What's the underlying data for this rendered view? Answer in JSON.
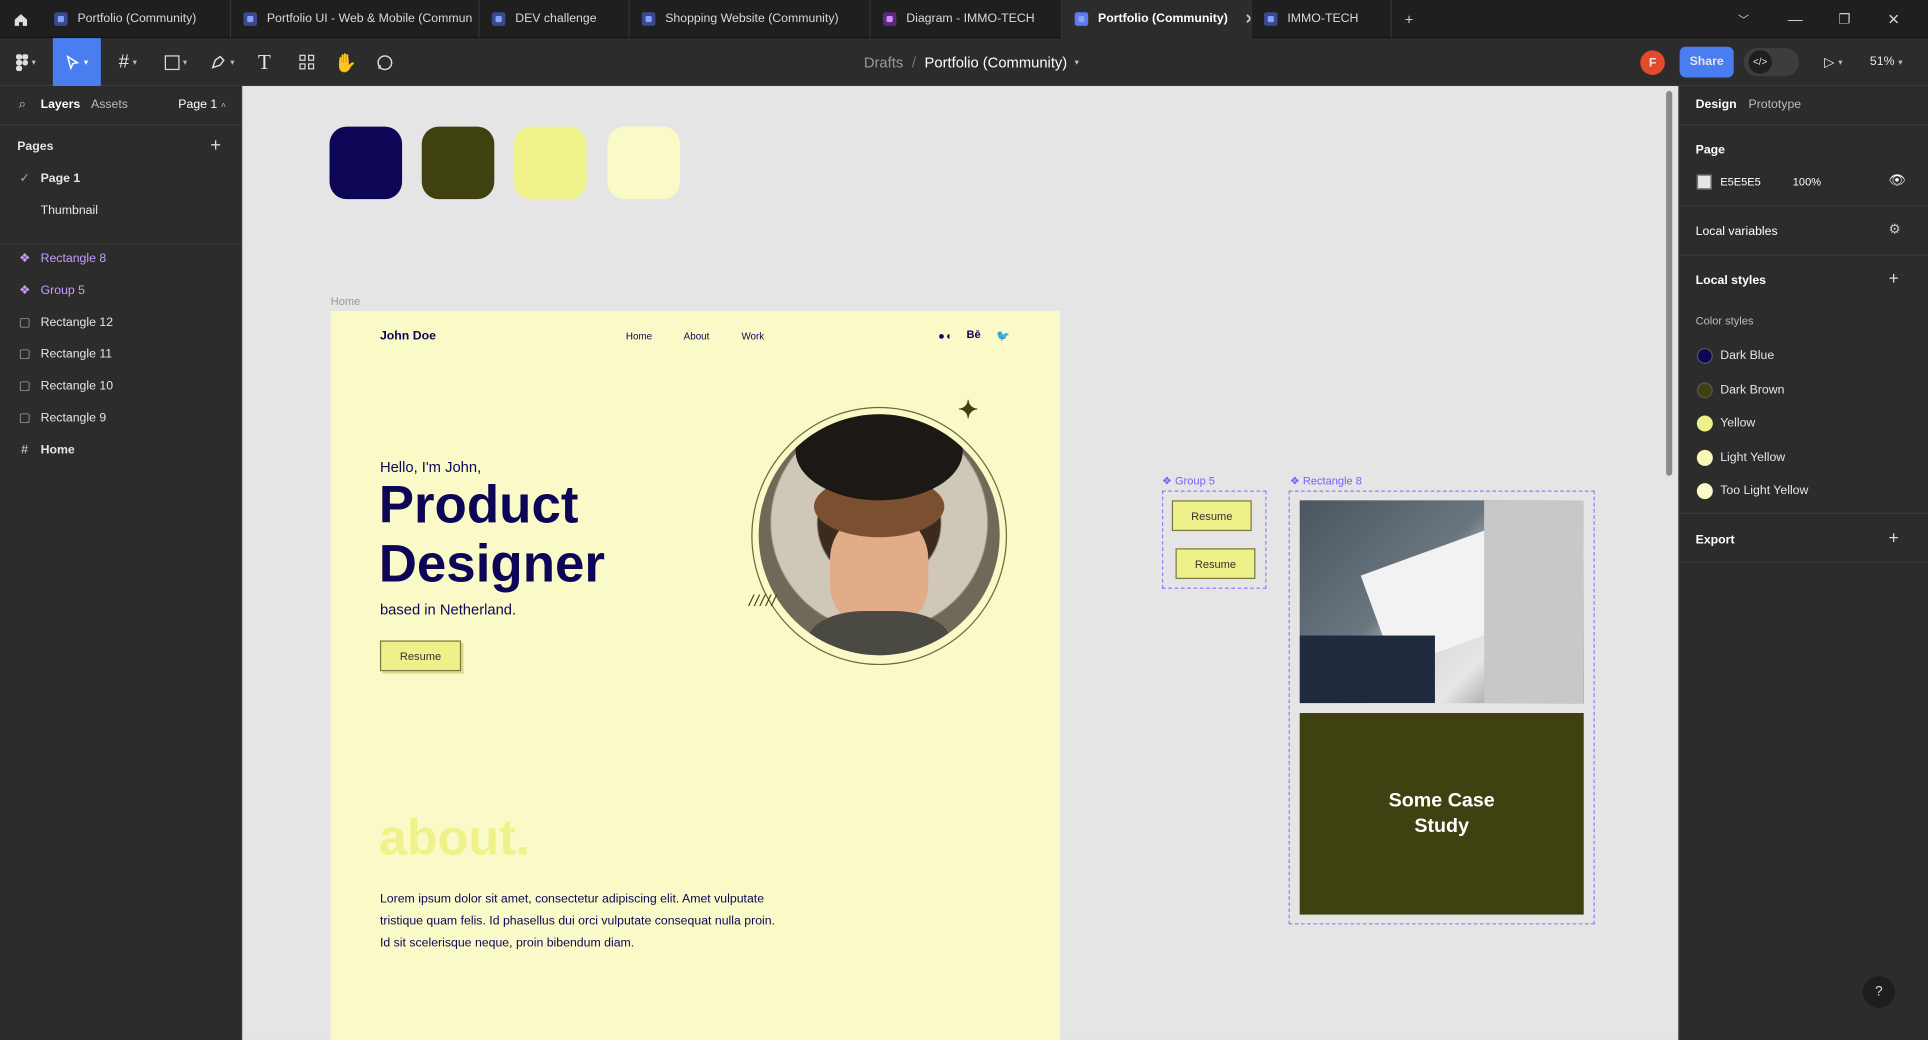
{
  "tabs": [
    {
      "label": "Portfolio (Community)",
      "icon": "figma-file-icon"
    },
    {
      "label": "Portfolio UI - Web & Mobile (Commun",
      "icon": "figma-file-icon"
    },
    {
      "label": "DEV challenge",
      "icon": "figma-file-icon"
    },
    {
      "label": "Shopping Website (Community)",
      "icon": "figma-file-icon"
    },
    {
      "label": "Diagram - IMMO-TECH",
      "icon": "figjam-file-icon"
    },
    {
      "label": "Portfolio (Community)",
      "icon": "figma-file-icon",
      "active": true
    },
    {
      "label": "IMMO-TECH",
      "icon": "figma-file-icon"
    }
  ],
  "toolbar": {
    "breadcrumb_root": "Drafts",
    "breadcrumb_sep": "/",
    "file_name": "Portfolio (Community)",
    "avatar_initial": "F",
    "share_label": "Share",
    "zoom_label": "51%"
  },
  "left_panel": {
    "tab_layers": "Layers",
    "tab_assets": "Assets",
    "page_selector": "Page 1",
    "pages_header": "Pages",
    "pages": [
      "Page 1",
      "Thumbnail"
    ],
    "layers": [
      {
        "label": "Rectangle 8",
        "icon": "component-icon",
        "highlight": true
      },
      {
        "label": "Group 5",
        "icon": "component-icon",
        "highlight": true
      },
      {
        "label": "Rectangle 12",
        "icon": "rectangle-icon"
      },
      {
        "label": "Rectangle 11",
        "icon": "rectangle-icon"
      },
      {
        "label": "Rectangle 10",
        "icon": "rectangle-icon"
      },
      {
        "label": "Rectangle 9",
        "icon": "rectangle-icon"
      },
      {
        "label": "Home",
        "icon": "frame-icon",
        "bold": true
      }
    ]
  },
  "canvas": {
    "swatches": [
      "#0d0656",
      "#3f4110",
      "#eff28a",
      "#fafac8"
    ],
    "frame_label": "Home",
    "site": {
      "logo": "John Doe",
      "nav": [
        "Home",
        "About",
        "Work"
      ],
      "social": [
        "Medium",
        "Bē",
        "Twitter"
      ],
      "hello": "Hello, I'm John,",
      "title_line1": "Product",
      "title_line2": "Designer",
      "based": "based in Netherland.",
      "resume": "Resume",
      "about_heading": "about.",
      "about_text": [
        "Lorem ipsum dolor sit amet, consectetur adipiscing elit. Amet vulputate",
        "tristique quam felis. Id phasellus dui orci vulputate consequat nulla proin.",
        "Id sit scelerisque neque, proin bibendum diam."
      ],
      "slashes": "/////"
    },
    "group5": {
      "label": "Group 5",
      "buttons": [
        "Resume",
        "Resume"
      ]
    },
    "rect8": {
      "label": "Rectangle 8",
      "case_study": "Some Case Study"
    }
  },
  "right_panel": {
    "tab_design": "Design",
    "tab_prototype": "Prototype",
    "page_header": "Page",
    "page_color": "E5E5E5",
    "page_opacity": "100%",
    "local_variables": "Local variables",
    "local_styles": "Local styles",
    "color_styles_header": "Color styles",
    "color_styles": [
      {
        "name": "Dark Blue",
        "color": "#0d0656"
      },
      {
        "name": "Dark Brown",
        "color": "#3f4110"
      },
      {
        "name": "Yellow",
        "color": "#eff28a"
      },
      {
        "name": "Light Yellow",
        "color": "#f7f7b8"
      },
      {
        "name": "Too Light Yellow",
        "color": "#fafac8"
      }
    ],
    "export": "Export"
  },
  "help": "?"
}
